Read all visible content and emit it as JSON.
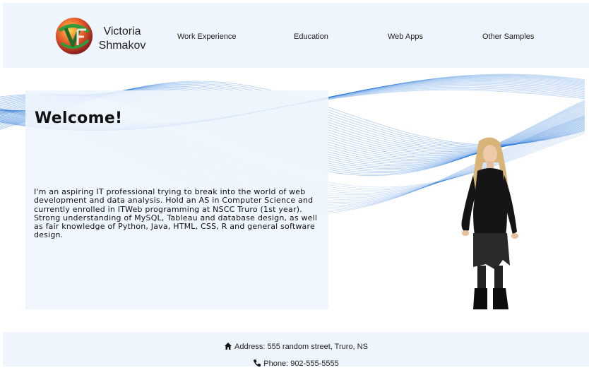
{
  "header": {
    "brand_line1": "Victoria",
    "brand_line2": "Shmakov",
    "logo_icon": "vs-monogram-logo",
    "nav": [
      {
        "label": "Work Experience"
      },
      {
        "label": "Education"
      },
      {
        "label": "Web Apps"
      },
      {
        "label": "Other Samples"
      }
    ]
  },
  "main": {
    "title": "Welcome!",
    "intro": "I'm an aspiring IT professional trying to break into the world of web development and data analysis. Hold an AS in Computer Science and currently enrolled in ITWeb programming at NSCC Truro (1st year). Strong understanding of MySQL, Tableau and database design, as well as fair knowledge of Python, Java, HTML, CSS, R and general software design."
  },
  "footer": {
    "address": "Address: 555 random street, Truro, NS",
    "phone": "Phone: 902-555-5555",
    "address_icon": "home-icon",
    "phone_icon": "phone-icon"
  },
  "colors": {
    "panel": "#eef5fd",
    "wave": "#1a6fd6",
    "text": "#111111"
  }
}
